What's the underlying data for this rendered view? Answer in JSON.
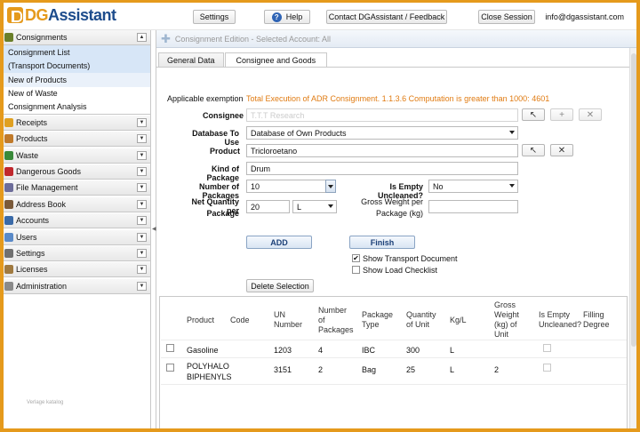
{
  "header": {
    "logo_dg": "DG",
    "logo_assistant": "Assistant",
    "settings": "Settings",
    "help": "Help",
    "contact": "Contact DGAssistant / Feedback",
    "close_session": "Close Session",
    "email": "info@dgassistant.com"
  },
  "sidebar": {
    "consignments": "Consignments",
    "sub_items": [
      "Consignment List",
      "(Transport Documents)",
      "New of Products",
      "New of Waste",
      "Consignment Analysis"
    ],
    "sections": [
      "Receipts",
      "Products",
      "Waste",
      "Dangerous Goods",
      "File Management",
      "Address Book",
      "Accounts",
      "Users",
      "Settings",
      "Licenses",
      "Administration"
    ],
    "footer_note": "Verlage katalog"
  },
  "breadcrumb": "Consignment Edition - Selected Account: All",
  "tabs": [
    "General Data",
    "Consignee and Goods"
  ],
  "form": {
    "applicable_exemption_label": "Applicable exemption",
    "applicable_exemption_value": "Total Execution of ADR Consignment. 1.1.3.6 Computation is greater than 1000: 4601",
    "consignee_label": "Consignee",
    "consignee_value": "T.T.T Research",
    "database_label": "Database To Use",
    "database_value": "Database of Own Products",
    "product_label": "Product",
    "product_value": "Tricloroetano",
    "kind_label": "Kind of Package",
    "kind_value": "Drum",
    "num_packages_label": "Number of Packages",
    "num_packages_value": "10",
    "empty_label": "Is Empty Uncleaned?",
    "empty_value": "No",
    "net_qty_label_1": "Net Quantity per",
    "net_qty_label_2": "Package",
    "net_qty_value": "20",
    "net_unit": "L",
    "gross_label_1": "Gross Weight per",
    "gross_label_2": "Package (kg)",
    "gross_value": ""
  },
  "actions": {
    "add": "ADD",
    "finish": "Finish",
    "show_transport": "Show Transport Document",
    "show_transport_checked": true,
    "show_load": "Show Load Checklist",
    "show_load_checked": false,
    "delete_selection": "Delete Selection"
  },
  "grid": {
    "columns": [
      "Product",
      "Code",
      "UN\nNumber",
      "Number\nof\nPackages",
      "Package\nType",
      "Quantity\nof Unit",
      "Kg/L",
      "Gross\nWeight\n(kg) of\nUnit",
      "Is Empty\nUncleaned?",
      "Filling\nDegree"
    ],
    "rows": [
      {
        "product": "Gasoline",
        "code": "",
        "un": "1203",
        "packages": "4",
        "type": "IBC",
        "qty": "300",
        "kgl": "L",
        "gross": "",
        "empty": false,
        "filling": ""
      },
      {
        "product": "POLYHALO\nBIPHENYLS",
        "code": "",
        "un": "3151",
        "packages": "2",
        "type": "Bag",
        "qty": "25",
        "kgl": "L",
        "gross": "2",
        "empty": false,
        "filling": ""
      }
    ]
  },
  "colors": {
    "accent": "#e59a1c",
    "brand": "#1d4c8c",
    "exemption": "#e07b12"
  }
}
